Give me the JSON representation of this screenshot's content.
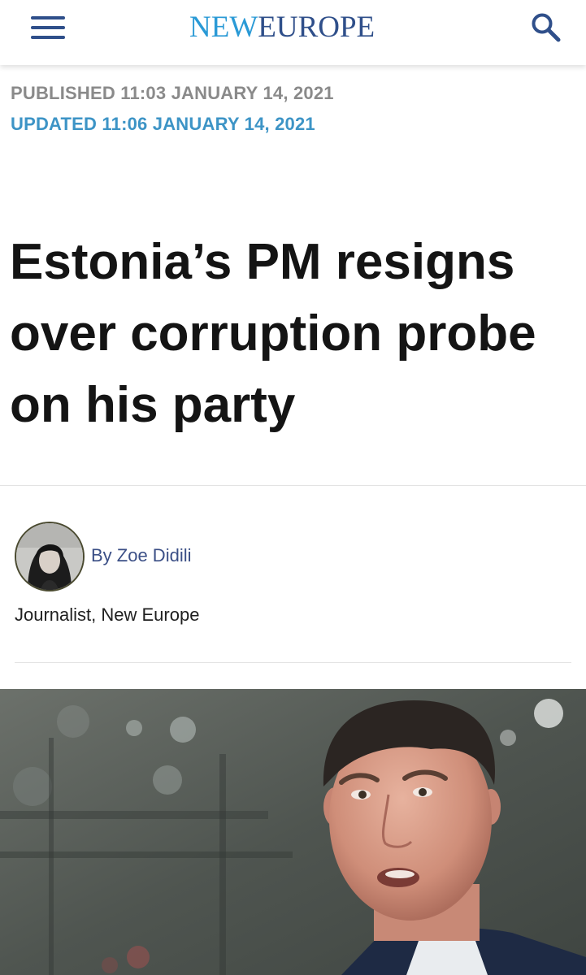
{
  "header": {
    "logo_new": "NEW",
    "logo_europe": "EUROPE",
    "menu_icon": "hamburger-menu-icon",
    "search_icon": "search-icon",
    "brand_color_dark": "#2f4f8a",
    "brand_color_light": "#2a9ad6"
  },
  "article": {
    "published": "PUBLISHED 11:03 JANUARY 14, 2021",
    "updated": "UPDATED 11:06 JANUARY 14, 2021",
    "headline": "Estonia’s PM resigns over corruption probe on his party",
    "author": {
      "byline": "By Zoe Didili",
      "role": "Journalist, New Europe"
    },
    "hero_image_subject": "photo of a man in a dark suit speaking"
  }
}
